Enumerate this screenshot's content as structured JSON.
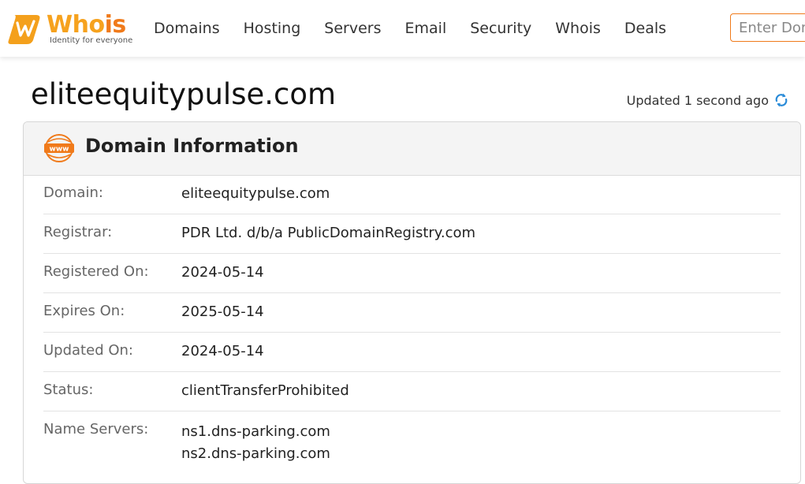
{
  "header": {
    "logo": {
      "word_who": "Who",
      "word_is": "is",
      "tagline": "Identity for everyone"
    },
    "nav": [
      "Domains",
      "Hosting",
      "Servers",
      "Email",
      "Security",
      "Whois",
      "Deals"
    ],
    "search": {
      "placeholder": "Enter Domain or IP",
      "value": ""
    }
  },
  "page": {
    "domain_title": "eliteequitypulse.com",
    "updated_text": "Updated 1 second ago"
  },
  "card": {
    "title": "Domain Information",
    "icon_text": "www",
    "rows": [
      {
        "label": "Domain:",
        "value": "eliteequitypulse.com"
      },
      {
        "label": "Registrar:",
        "value": "PDR Ltd. d/b/a PublicDomainRegistry.com"
      },
      {
        "label": "Registered On:",
        "value": "2024-05-14"
      },
      {
        "label": "Expires On:",
        "value": "2025-05-14"
      },
      {
        "label": "Updated On:",
        "value": "2024-05-14"
      },
      {
        "label": "Status:",
        "value": "clientTransferProhibited"
      },
      {
        "label": "Name Servers:",
        "values": [
          "ns1.dns-parking.com",
          "ns2.dns-parking.com"
        ]
      }
    ]
  },
  "colors": {
    "brand_orange": "#f07a1a",
    "brand_yellow": "#f6a21e",
    "refresh_blue": "#2a8bd8"
  }
}
